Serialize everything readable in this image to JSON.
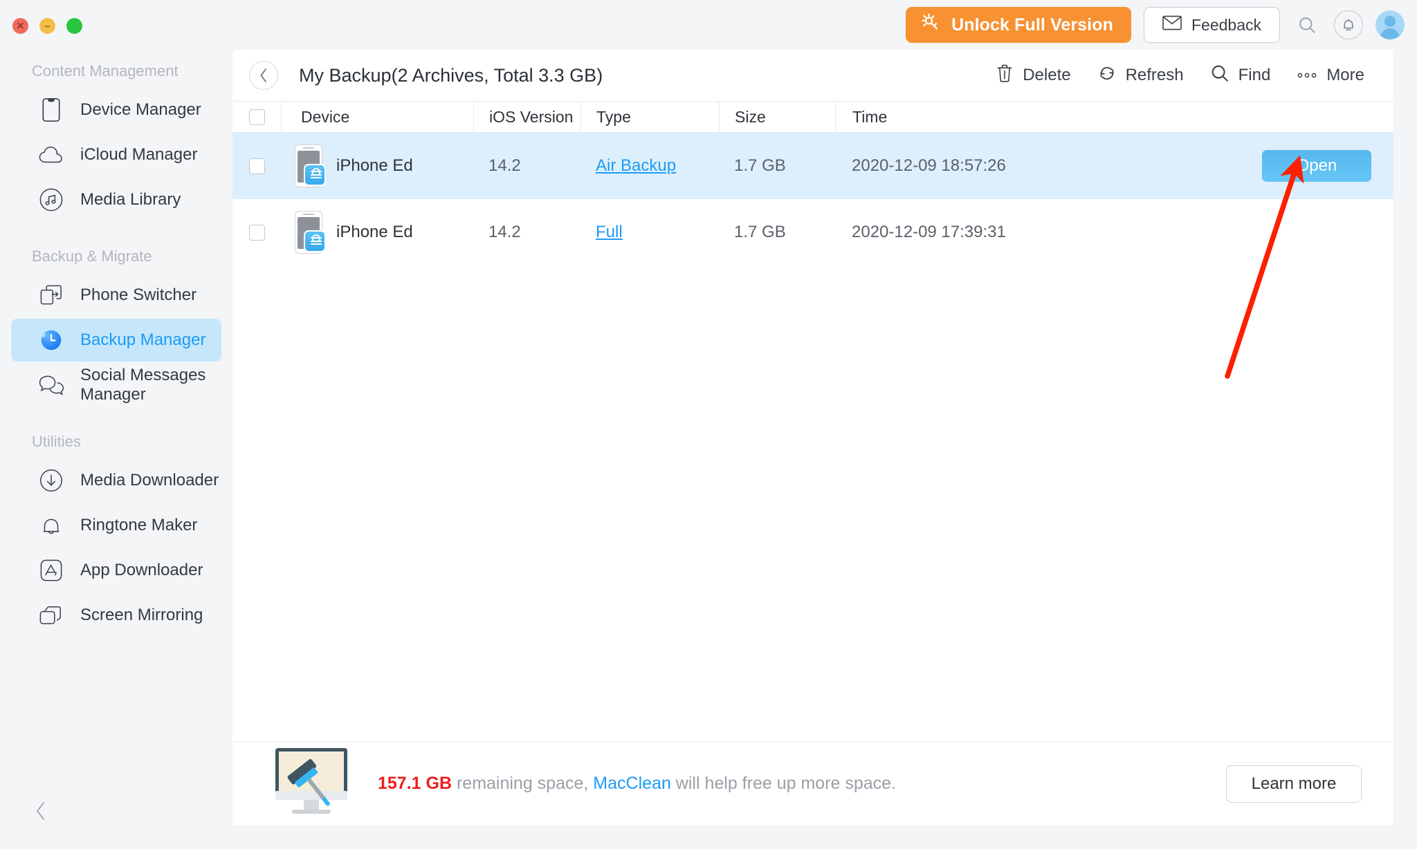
{
  "window": {
    "traffic_lights": [
      {
        "name": "close",
        "glyph": "✕",
        "color": "#ef6b5e"
      },
      {
        "name": "minimize",
        "glyph": "–",
        "color": "#f4bd46"
      },
      {
        "name": "maximize",
        "glyph": "⬌",
        "color": "#2ac63f"
      }
    ]
  },
  "topbar": {
    "unlock_label": "Unlock Full Version",
    "feedback_label": "Feedback",
    "search_icon": "search-icon",
    "bell_icon": "bell-icon",
    "avatar_icon": "user-avatar"
  },
  "sidebar": {
    "sections": [
      {
        "title": "Content Management",
        "items": [
          {
            "label": "Device Manager",
            "icon": "phone-outline-icon",
            "active": false
          },
          {
            "label": "iCloud Manager",
            "icon": "cloud-icon",
            "active": false
          },
          {
            "label": "Media Library",
            "icon": "music-note-circle-icon",
            "active": false
          }
        ]
      },
      {
        "title": "Backup & Migrate",
        "items": [
          {
            "label": "Phone Switcher",
            "icon": "phone-transfer-icon",
            "active": false
          },
          {
            "label": "Backup Manager",
            "icon": "clock-icon",
            "active": true
          },
          {
            "label": "Social Messages Manager",
            "icon": "chat-bubbles-icon",
            "active": false
          }
        ]
      },
      {
        "title": "Utilities",
        "items": [
          {
            "label": "Media Downloader",
            "icon": "download-circle-icon",
            "active": false
          },
          {
            "label": "Ringtone Maker",
            "icon": "bell-outline-icon",
            "active": false
          },
          {
            "label": "App Downloader",
            "icon": "appstore-icon",
            "active": false
          },
          {
            "label": "Screen Mirroring",
            "icon": "screens-stack-icon",
            "active": false
          }
        ]
      }
    ],
    "collapse_icon": "chevron-left-icon"
  },
  "content": {
    "back_icon": "chevron-left-icon",
    "title": "My Backup(2 Archives, Total  3.3 GB)",
    "tools": [
      {
        "label": "Delete",
        "icon": "trash-icon"
      },
      {
        "label": "Refresh",
        "icon": "refresh-icon"
      },
      {
        "label": "Find",
        "icon": "search-icon"
      },
      {
        "label": "More",
        "icon": "ellipsis-icon"
      }
    ],
    "table": {
      "columns": [
        "Device",
        "iOS Version",
        "Type",
        "Size",
        "Time"
      ],
      "rows": [
        {
          "device": "iPhone Ed",
          "ios_version": "14.2",
          "type": "Air Backup",
          "size": "1.7 GB",
          "time": "2020-12-09 18:57:26",
          "selected": true,
          "action_label": "Open",
          "checked": false
        },
        {
          "device": "iPhone Ed",
          "ios_version": "14.2",
          "type": "Full",
          "size": "1.7 GB",
          "time": "2020-12-09 17:39:31",
          "selected": false,
          "action_label": "",
          "checked": false
        }
      ]
    },
    "promo": {
      "icon": "imac-cleaner-icon",
      "amount": "157.1 GB",
      "text_mid": " remaining space, ",
      "brand": "MacClean",
      "text_end": " will help free up more space.",
      "button_label": "Learn more"
    }
  },
  "annotation": {
    "arrow_color": "#fc2000",
    "points_to": "Open"
  },
  "colors": {
    "accent_blue": "#1d9bf5",
    "orange": "#f79132",
    "selected_row": "#ddeffc",
    "sidebar_bg": "#f4f5f7",
    "red": "#ef1d1d"
  }
}
